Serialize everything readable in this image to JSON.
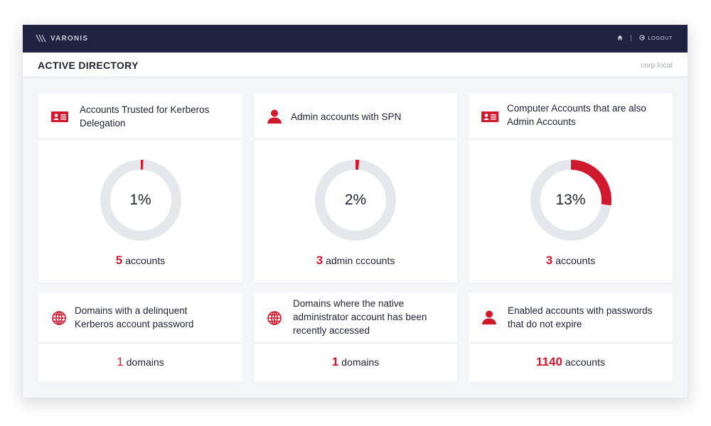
{
  "header": {
    "brand": "VARONIS",
    "home_icon": "home-icon",
    "separator": "|",
    "logout_label": "LOGOUT",
    "logout_icon": "logout-icon"
  },
  "subheader": {
    "title": "ACTIVE DIRECTORY",
    "domain": "corp.local"
  },
  "colors": {
    "accent": "#d0192e",
    "navbar": "#1f2340",
    "ring_track": "#e4e7eb",
    "content_bg": "#f3f5f9"
  },
  "cards": [
    {
      "title": "Accounts Trusted for Kerberos Delegation",
      "icon": "id-card-icon",
      "percent_label": "1%",
      "percent": 1,
      "ring_fill_fraction": 0.01,
      "count": "5",
      "unit": "accounts"
    },
    {
      "title": "Admin accounts with SPN",
      "icon": "user-icon",
      "percent_label": "2%",
      "percent": 2,
      "ring_fill_fraction": 0.015,
      "count": "3",
      "unit": "admin cccounts"
    },
    {
      "title": "Computer Accounts that are also Admin Accounts",
      "icon": "id-card-icon",
      "percent_label": "13%",
      "percent": 13,
      "ring_fill_fraction": 0.27,
      "count": "3",
      "unit": "accounts"
    },
    {
      "title": "Domains with a delinquent Kerberos account password",
      "icon": "globe-icon",
      "count": "1",
      "unit": "domains"
    },
    {
      "title": "Domains where the native administrator account has been recently accessed",
      "icon": "globe-icon",
      "count": "1",
      "unit": "domains"
    },
    {
      "title": "Enabled accounts with passwords that do not expire",
      "icon": "user-icon",
      "count": "1140",
      "unit": "accounts"
    }
  ]
}
